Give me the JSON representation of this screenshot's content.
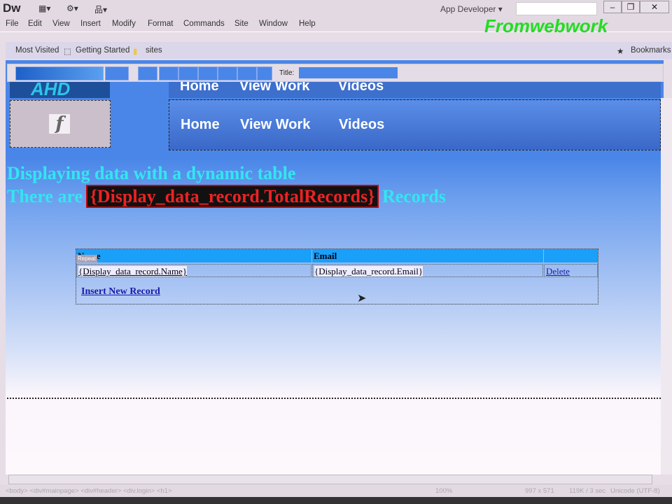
{
  "app": {
    "logo": "Dw",
    "workspace": "App Developer",
    "watermark": "Fromwebwork"
  },
  "menu": [
    "File",
    "Edit",
    "View",
    "Insert",
    "Modify",
    "Format",
    "Commands",
    "Site",
    "Window",
    "Help"
  ],
  "bookmarks": {
    "items": [
      "Most Visited",
      "Getting Started",
      "sites"
    ],
    "right": "Bookmarks"
  },
  "toolbar": {
    "title_label": "Title:"
  },
  "header": {
    "logo_text": "AHD",
    "nav": [
      "Home",
      "View Work",
      "Videos"
    ]
  },
  "content": {
    "heading": "Displaying data with a dynamic table",
    "line_prefix": "There are",
    "total": "{Display_data_record.TotalRecords}",
    "line_suffix": "Records",
    "table": {
      "headers": [
        "Name",
        "Email",
        ""
      ],
      "repeat_tag": "Repeat",
      "row": [
        "{Display_data_record.Name}",
        "{Display_data_record.Email}",
        "Delete"
      ]
    },
    "insert_link": "Insert New Record"
  },
  "status": {
    "path": "<body> <div#mainpage> <div#header> <div.login> <h1>",
    "zoom": "100%",
    "size": "997 x 571",
    "download": "119K / 3 sec",
    "encoding": "Unicode (UTF-8)"
  }
}
